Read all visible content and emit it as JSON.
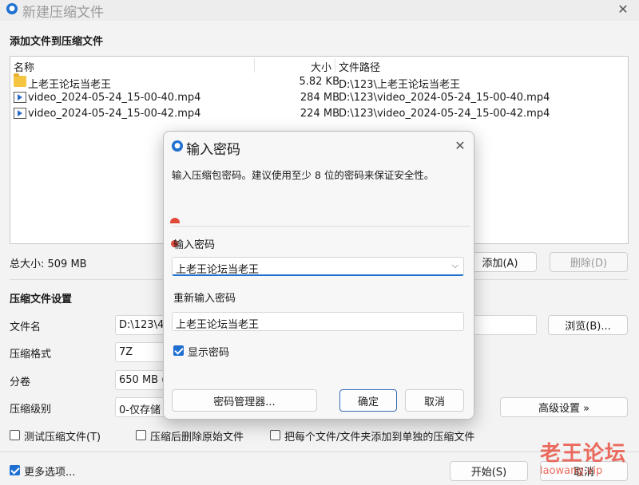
{
  "window": {
    "title": "新建压缩文件"
  },
  "add_section": {
    "title": "添加文件到压缩文件"
  },
  "file_list": {
    "columns": {
      "name": "名称",
      "size": "大小",
      "path": "文件路径"
    },
    "rows": [
      {
        "name": "上老王论坛当老王",
        "size": "5.82 KB",
        "path": "D:\\123\\上老王论坛当老王",
        "icon": "folder-icon"
      },
      {
        "name": "video_2024-05-24_15-00-40.mp4",
        "size": "284 MB",
        "path": "D:\\123\\video_2024-05-24_15-00-40.mp4",
        "icon": "video-file-icon"
      },
      {
        "name": "video_2024-05-24_15-00-42.mp4",
        "size": "224 MB",
        "path": "D:\\123\\video_2024-05-24_15-00-42.mp4",
        "icon": "video-file-icon"
      }
    ]
  },
  "total_size": "总大小: 509 MB",
  "buttons": {
    "add": "添加(A)",
    "remove": "删除(D)",
    "browse": "浏览(B)...",
    "advanced": "高级设置 »",
    "start": "开始(S)",
    "cancel_main": "取消"
  },
  "settings": {
    "title": "压缩文件设置",
    "filename_label": "文件名",
    "filename_value": "D:\\123\\4",
    "format_label": "压缩格式",
    "format_value": "7Z",
    "split_label": "分卷",
    "split_value": "650 MB (",
    "level_label": "压缩级别",
    "level_value": "0-仅存储"
  },
  "options": {
    "test": "测试压缩文件(T)",
    "delete_after": "压缩后删除原始文件",
    "separate": "把每个文件/文件夹添加到单独的压缩文件",
    "more": "更多选项..."
  },
  "dialog": {
    "title": "输入密码",
    "hint": "输入压缩包密码。建议使用至少 8 位的密码来保证安全性。",
    "password_label": "输入密码",
    "password_value": "上老王论坛当老王",
    "confirm_label": "重新输入密码",
    "confirm_value": "上老王论坛当老王",
    "show_password": "显示密码",
    "manager_button": "密码管理器...",
    "ok_button": "确定",
    "cancel_button": "取消"
  },
  "watermark": {
    "text": "老王论坛",
    "url": "laowang.vip"
  },
  "colors": {
    "accent": "#1f6fd1",
    "watermark": "#e94a3a"
  }
}
